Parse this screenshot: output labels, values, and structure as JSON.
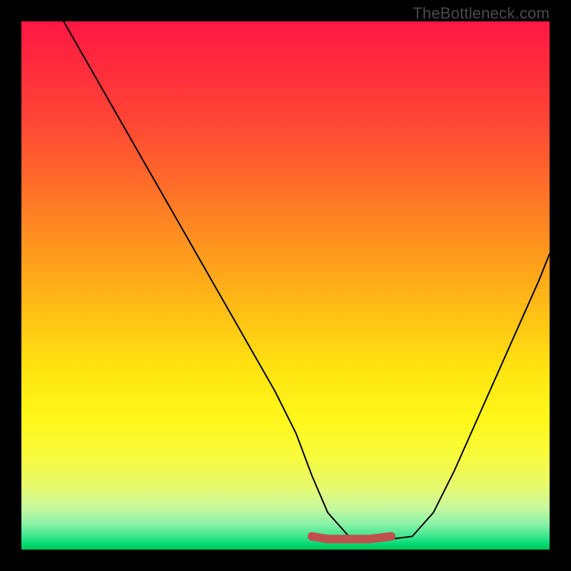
{
  "watermark": "TheBottleneck.com",
  "chart_data": {
    "type": "line",
    "title": "",
    "xlabel": "",
    "ylabel": "",
    "xlim": [
      0,
      100
    ],
    "ylim": [
      0,
      100
    ],
    "grid": false,
    "legend": false,
    "series": [
      {
        "name": "bottleneck-curve",
        "color": "#000000",
        "x": [
          8,
          12,
          16,
          20,
          24,
          28,
          32,
          36,
          40,
          44,
          48,
          52,
          55,
          58,
          62,
          66,
          70,
          74,
          78,
          82,
          86,
          90,
          94,
          98,
          100
        ],
        "values": [
          100,
          93,
          86,
          79,
          72,
          65,
          58,
          51,
          44,
          37,
          30,
          22,
          14,
          7,
          2.5,
          2,
          2,
          2.5,
          7,
          15,
          24,
          33,
          42,
          51,
          56
        ]
      },
      {
        "name": "optimal-range-band",
        "color": "#c0504d",
        "x": [
          55,
          58,
          62,
          66,
          70
        ],
        "values": [
          2.5,
          2,
          2,
          2,
          2.5
        ]
      }
    ],
    "annotations": []
  }
}
